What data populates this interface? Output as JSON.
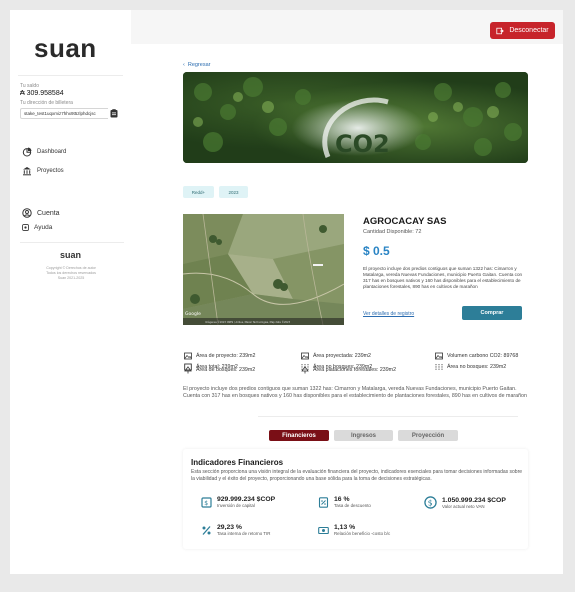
{
  "header": {
    "logout_label": "Desconectar"
  },
  "sidebar": {
    "logo": "suan",
    "saldo_label": "Tu saldo",
    "saldo_value": "309.958584",
    "wallet_label": "Tu dirección de billetera",
    "wallet_value": "stake_test1uqxmiz7hhx9t5zlphdcjsc",
    "nav": {
      "dashboard": "Dashboard",
      "proyectos": "Proyectos",
      "cuenta": "Cuenta",
      "ayuda": "Ayuda"
    },
    "footer_logo": "suan",
    "copyright_lines": [
      "Copyright © Derechos de autor",
      "Todos los derechos reservados",
      "Suan 2021-2025"
    ]
  },
  "main": {
    "back_label": "Regresar",
    "hero_text": "CO2",
    "tags": [
      "Redd+",
      "2023"
    ],
    "company": "AGROCACAY SAS",
    "quantity": "Cantidad Disponible: 72",
    "price": "$ 0.5",
    "short_description": "El proyecto incluye dos predios contiguos que suman 1322 has: Cimarron y Matalarga, vereda Nuevas Fundaciones, municipio Puerto Gaitan. Cuenta con 317 has en bosques nativos y 160 has disponibles para el establecimiento de plantaciones forestales, 890 has en cultivos de marañon",
    "details_link": "Ver detalles de registro",
    "buy_label": "Comprar",
    "map_attribution": "Imágenes ©2023 CNES / Airbus, Maxar Technologies, Map data ©2023",
    "areas": [
      {
        "label": "Área total: 239m2",
        "icon": "square-icon"
      },
      {
        "label": "Área no bosques: 239m2",
        "icon": "tree-split-icon"
      },
      {
        "label": "Área no bosques: 239m2",
        "icon": "tree-split-icon"
      },
      {
        "label": "Área de proyecto: 239m2",
        "icon": "landscape-icon"
      },
      {
        "label": "Área proyectada: 239m2",
        "icon": "landscape-icon"
      },
      {
        "label": "Volumen carbono CO2: 89768",
        "icon": "landscape-icon"
      },
      {
        "label": "Área de bosques: 239m2",
        "icon": "tree-icon"
      },
      {
        "label": "Área plataciones forestales: 239m2",
        "icon": "tree-icon"
      }
    ],
    "long_description": "El proyecto incluye dos predios contiguos que suman 1322 has: Cimarron y Matalarga, vereda Nuevas Fundaciones, municipio Puerto Gaitan. Cuenta con 317 has en bosques nativos y 160 has disponibles para el establecimiento de plantaciones forestales, 890 has en cultivos de marañon",
    "tabs": [
      "Financieros",
      "Ingresos",
      "Proyección"
    ],
    "financial": {
      "title": "Indicadores Financieros",
      "description": "Esta sección proporciona una visión integral de la evaluación financiera del proyecto, indicadores esenciales para tomar decisiones informadas sobre la viabilidad y el éxito del proyecto, proporcionando una base sólida para la toma de decisiones estratégicas.",
      "kpis": [
        {
          "value": "929.999.234 $COP",
          "label": "Inversión de capital"
        },
        {
          "value": "16 %",
          "label": "Tasa de descuento"
        },
        {
          "value": "1.050.999.234 $COP",
          "label": "Valor actual neto VAN"
        },
        {
          "value": "29,23 %",
          "label": "Tasa interna de retorno TIR"
        },
        {
          "value": "1,13 %",
          "label": "Relación beneficio -costo b/c"
        }
      ]
    }
  },
  "colors": {
    "accent_red": "#c7242b",
    "tab_active": "#7a0f16",
    "buy_button": "#2d7e98",
    "price_blue": "#2a84c4"
  }
}
